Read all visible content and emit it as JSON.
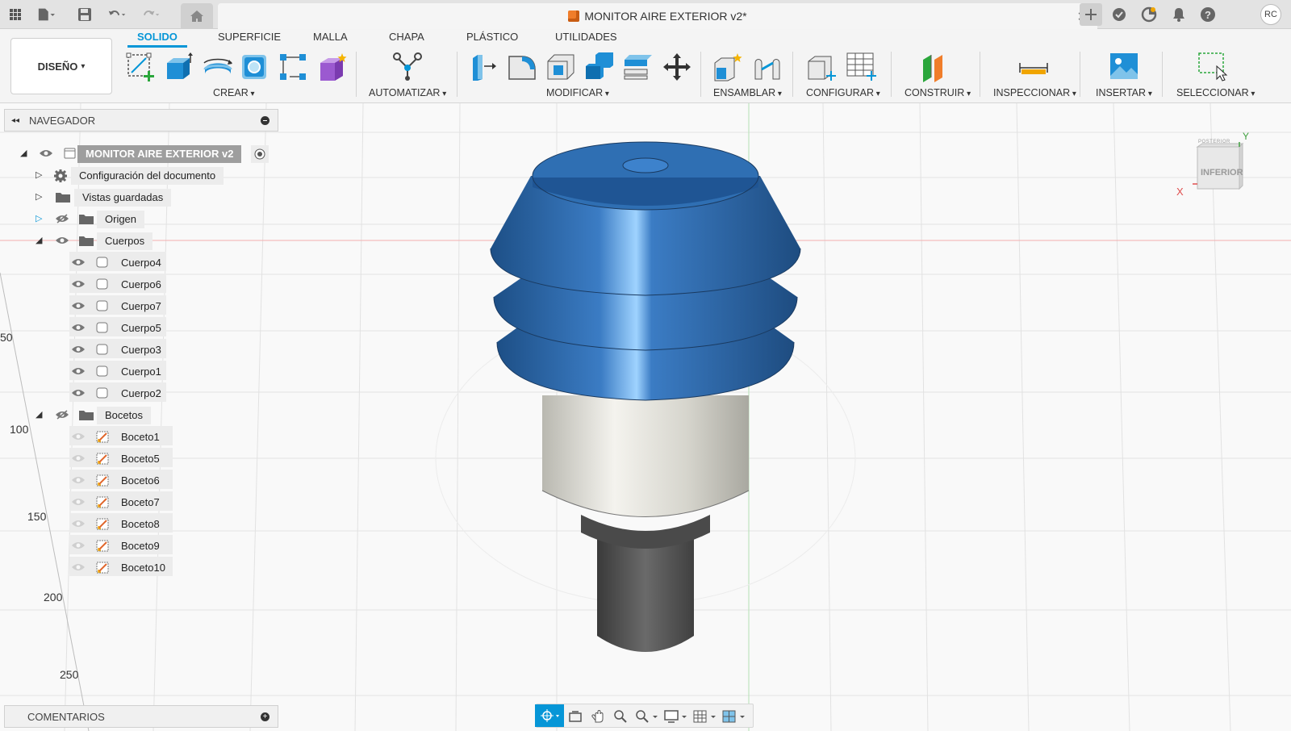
{
  "app": {
    "document_title": "MONITOR AIRE EXTERIOR v2*",
    "user_initials": "RC"
  },
  "ribbon": {
    "workspace": "DISEÑO",
    "tabs": [
      "SOLIDO",
      "SUPERFICIE",
      "MALLA",
      "CHAPA",
      "PLÁSTICO",
      "UTILIDADES"
    ],
    "active_tab": "SOLIDO",
    "groups": [
      "CREAR",
      "AUTOMATIZAR",
      "MODIFICAR",
      "ENSAMBLAR",
      "CONFIGURAR",
      "CONSTRUIR",
      "INSPECCIONAR",
      "INSERTAR",
      "SELECCIONAR"
    ]
  },
  "browser": {
    "title": "NAVEGADOR",
    "root": "MONITOR AIRE EXTERIOR v2",
    "doc_settings": "Configuración del documento",
    "saved_views": "Vistas guardadas",
    "origin": "Origen",
    "bodies_folder": "Cuerpos",
    "bodies": [
      "Cuerpo4",
      "Cuerpo6",
      "Cuerpo7",
      "Cuerpo5",
      "Cuerpo3",
      "Cuerpo1",
      "Cuerpo2"
    ],
    "sketches_folder": "Bocetos",
    "sketches": [
      "Boceto1",
      "Boceto5",
      "Boceto6",
      "Boceto7",
      "Boceto8",
      "Boceto9",
      "Boceto10"
    ]
  },
  "comments": {
    "title": "COMENTARIOS"
  },
  "viewport": {
    "ruler_labels": [
      "50",
      "100",
      "150",
      "200",
      "250"
    ],
    "viewcube_face": "INFERIOR",
    "viewcube_top": "POSTERIOR",
    "axis_x": "X",
    "axis_y": "Y"
  },
  "colors": {
    "accent": "#0696d7",
    "cap_blue": "#2f6fb3",
    "body_silver": "#d9d9d3",
    "pipe_gray": "#5a5a5a"
  }
}
